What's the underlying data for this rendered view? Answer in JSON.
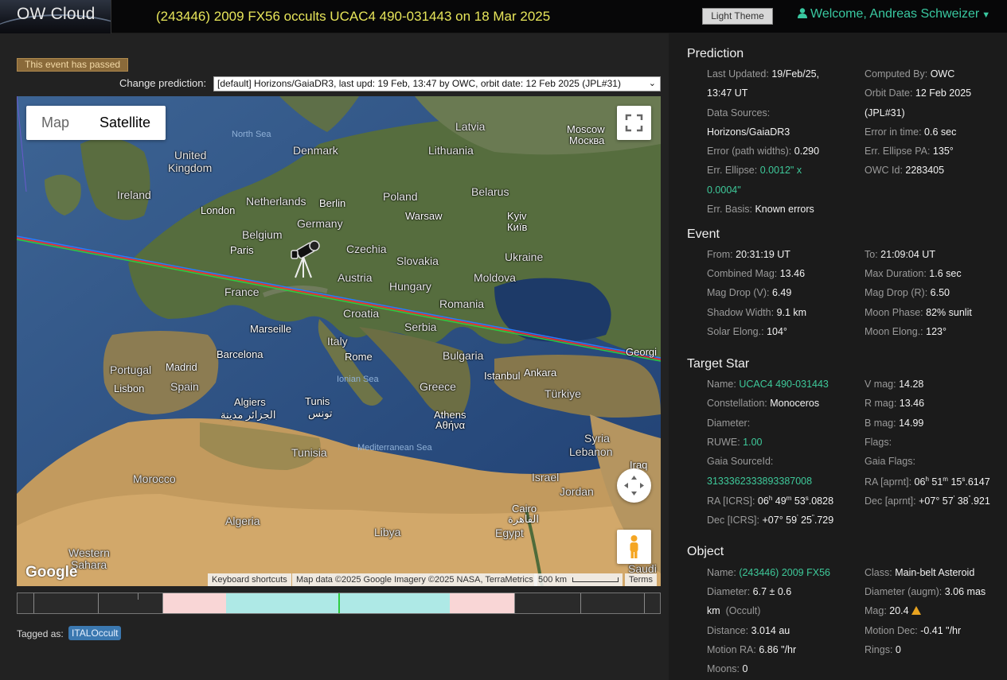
{
  "app": {
    "brand": "OW Cloud"
  },
  "header": {
    "event_title": "(243446) 2009 FX56 occults UCAC4 490-031443 on 18 Mar 2025",
    "theme_button": "Light Theme",
    "welcome": "Welcome, Andreas Schweizer"
  },
  "main": {
    "passed_badge": "This event has passed",
    "change_prediction_label": "Change prediction:",
    "prediction_select": "[default] Horizons/GaiaDR3, last upd: 19 Feb, 13:47 by OWC, orbit date: 12 Feb 2025 (JPL#31)",
    "tagged_label": "Tagged as:",
    "tag": "ITALOccult"
  },
  "map": {
    "type_map": "Map",
    "type_satellite": "Satellite",
    "google": "Google",
    "shortcuts": "Keyboard shortcuts",
    "map_data": "Map data ©2025 Google Imagery ©2025 NASA, TerraMetrics",
    "scale": "500 km",
    "terms": "Terms",
    "labels": {
      "north_sea": "North Sea",
      "denmark": "Denmark",
      "latvia": "Latvia",
      "lithuania": "Lithuania",
      "moscow": "Moscow",
      "moscow_cyr": "Москва",
      "uk1": "United",
      "uk2": "Kingdom",
      "ireland": "Ireland",
      "netherlands": "Netherlands",
      "berlin": "Berlin",
      "poland": "Poland",
      "belarus": "Belarus",
      "london": "London",
      "germany": "Germany",
      "warsaw": "Warsaw",
      "kyiv": "Kyiv",
      "kyiv_cyr": "Київ",
      "belgium": "Belgium",
      "paris": "Paris",
      "czechia": "Czechia",
      "slovakia": "Slovakia",
      "ukraine": "Ukraine",
      "austria": "Austria",
      "moldova": "Moldova",
      "hungary": "Hungary",
      "france": "France",
      "romania": "Romania",
      "croatia": "Croatia",
      "marseille": "Marseille",
      "serbia": "Serbia",
      "italy": "Italy",
      "barcelona": "Barcelona",
      "rome": "Rome",
      "bulgaria": "Bulgaria",
      "portugal": "Portugal",
      "madrid": "Madrid",
      "istanbul": "Istanbul",
      "ankara": "Ankara",
      "lisbon": "Lisbon",
      "spain": "Spain",
      "greece": "Greece",
      "turkiye": "Türkiye",
      "ionian_sea": "Ionian Sea",
      "algiers": "Algiers",
      "algiers_ar": "الجزائر مدينة",
      "tunis": "Tunis",
      "tunis_ar": "تونس",
      "athens": "Athens",
      "athens_gr": "Αθήνα",
      "syria": "Syria",
      "tunisia": "Tunisia",
      "med_sea": "Mediterranean Sea",
      "lebanon": "Lebanon",
      "iraq": "Iraq",
      "morocco": "Morocco",
      "israel": "Israel",
      "jordan": "Jordan",
      "algeria": "Algeria",
      "libya": "Libya",
      "cairo": "Cairo",
      "cairo_ar": "القاهرة",
      "egypt": "Egypt",
      "western1": "Western",
      "western2": "Sahara",
      "saudi": "Saudi",
      "georgia": "Georgi"
    }
  },
  "prediction": {
    "title": "Prediction",
    "last_updated_k": "Last Updated:",
    "last_updated_v1": "19/Feb/25,",
    "last_updated_v2": "13:47 UT",
    "computed_by_k": "Computed By:",
    "computed_by_v": "OWC",
    "data_sources_k": "Data Sources:",
    "data_sources_v": "Horizons/GaiaDR3",
    "orbit_date_k": "Orbit Date:",
    "orbit_date_v1": "12 Feb 2025",
    "orbit_date_v2": "(JPL#31)",
    "error_time_k": "Error in time:",
    "error_time_v": "0.6 sec",
    "error_path_k": "Error (path widths):",
    "error_path_v": "0.290",
    "err_pa_k": "Err. Ellipse PA:",
    "err_pa_v": "135°",
    "err_ellipse_k": "Err. Ellipse:",
    "err_ellipse_v1": "0.0012\" x",
    "err_ellipse_v2": "0.0004\"",
    "owc_id_k": "OWC Id:",
    "owc_id_v": "2283405",
    "err_basis_k": "Err. Basis:",
    "err_basis_v": "Known errors"
  },
  "event": {
    "title": "Event",
    "from_k": "From:",
    "from_v": "20:31:19 UT",
    "to_k": "To:",
    "to_v": "21:09:04 UT",
    "comb_mag_k": "Combined Mag:",
    "comb_mag_v": "13.46",
    "max_dur_k": "Max Duration:",
    "max_dur_v": "1.6 sec",
    "drop_v_k": "Mag Drop (V):",
    "drop_v_v": "6.49",
    "drop_r_k": "Mag Drop (R):",
    "drop_r_v": "6.50",
    "shadow_k": "Shadow Width:",
    "shadow_v": "9.1 km",
    "moon_phase_k": "Moon Phase:",
    "moon_phase_v": "82% sunlit",
    "solar_k": "Solar Elong.:",
    "solar_v": "104°",
    "moon_el_k": "Moon Elong.:",
    "moon_el_v": "123°"
  },
  "target": {
    "title": "Target Star",
    "name_k": "Name:",
    "name_v": "UCAC4 490-031443",
    "vmag_k": "V mag:",
    "vmag_v": "14.28",
    "const_k": "Constellation:",
    "const_v": "Monoceros",
    "rmag_k": "R mag:",
    "rmag_v": "13.46",
    "diam_k": "Diameter:",
    "bmag_k": "B mag:",
    "bmag_v": "14.99",
    "ruwe_k": "RUWE:",
    "ruwe_v": "1.00",
    "flags_k": "Flags:",
    "gaia_src_k": "Gaia SourceId:",
    "gaia_flags_k": "Gaia Flags:",
    "gaia_src_v": "3133362333893387008",
    "ra_aprnt_k": "RA [aprnt]:",
    "ra_aprnt_h": "06",
    "ra_aprnt_m": "51",
    "ra_aprnt_s": "15",
    "ra_aprnt_f": ".6147",
    "ra_icrs_k": "RA [ICRS]:",
    "ra_icrs_h": "06",
    "ra_icrs_m": "49",
    "ra_icrs_s": "53",
    "ra_icrs_f": ".0828",
    "dec_aprnt_k": "Dec [aprnt]:",
    "dec_aprnt_d": "+07°",
    "dec_aprnt_m": "57",
    "dec_aprnt_s": "38",
    "dec_aprnt_f": ".921",
    "dec_icrs_k": "Dec [ICRS]:",
    "dec_icrs_d": "+07°",
    "dec_icrs_m": "59",
    "dec_icrs_s": "25",
    "dec_icrs_f": ".729"
  },
  "object": {
    "title": "Object",
    "name_k": "Name:",
    "name_v": "(243446) 2009 FX56",
    "class_k": "Class:",
    "class_v": "Main-belt Asteroid",
    "diam_k": "Diameter:",
    "diam_v1": "6.7 ± 0.6",
    "diam_v2": "km",
    "diam_v3": "(Occult)",
    "diam_augm_k": "Diameter (augm):",
    "diam_augm_v": "3.06 mas",
    "mag_k": "Mag:",
    "mag_v": "20.4",
    "dist_k": "Distance:",
    "dist_v": "3.014 au",
    "mdec_k": "Motion Dec:",
    "mdec_v": "-0.41 \"/hr",
    "mra_k": "Motion RA:",
    "mra_v": "6.86 \"/hr",
    "rings_k": "Rings:",
    "rings_v": "0",
    "moons_k": "Moons:",
    "moons_v": "0"
  },
  "timeline": {
    "bands": [
      {
        "from": 0.225,
        "to": 0.325,
        "color": "#f9d6d6"
      },
      {
        "from": 0.325,
        "to": 0.673,
        "color": "#aee9e6"
      },
      {
        "from": 0.673,
        "to": 0.773,
        "color": "#f9d6d6"
      }
    ],
    "event_mark": 0.499
  },
  "colors": {
    "accent_green": "#3ec99a",
    "title_yellow": "#e7e55a",
    "badge_blue": "#3b78b0"
  }
}
